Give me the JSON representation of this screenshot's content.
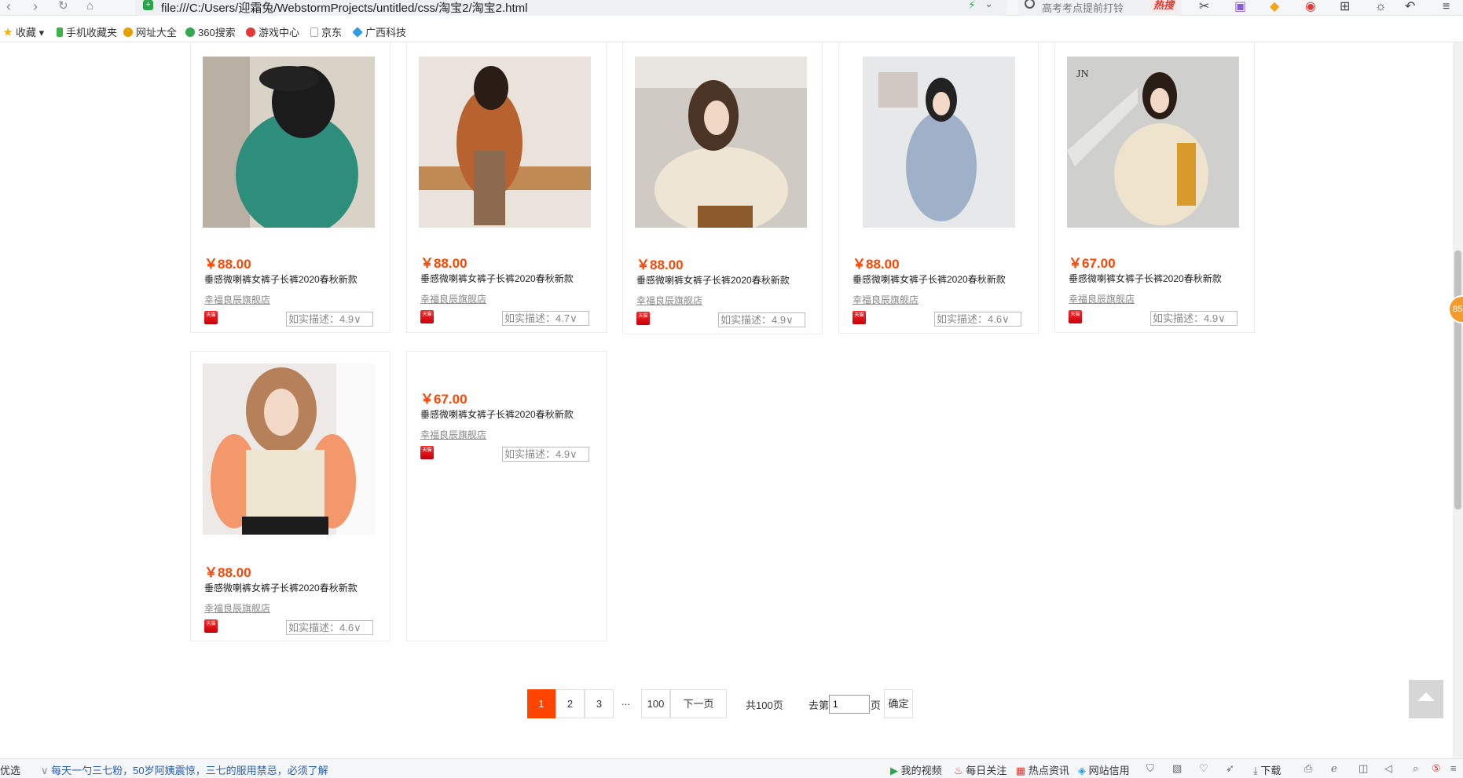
{
  "browser": {
    "url": "file:///C:/Users/迎霜兔/WebstormProjects/untitled/css/淘宝2/淘宝2.html",
    "search_placeholder": "高考考点提前打铃",
    "search_hot": "热搜"
  },
  "bookmarks": [
    {
      "label": "收藏",
      "icon": "star-icon",
      "color": "#f6b400"
    },
    {
      "label": "手机收藏夹",
      "icon": "phone-icon",
      "color": "#3bb34a"
    },
    {
      "label": "网址大全",
      "icon": "globe-icon",
      "color": "#e5a000"
    },
    {
      "label": "360搜索",
      "icon": "search360-icon",
      "color": "#32a852"
    },
    {
      "label": "游戏中心",
      "icon": "game-icon",
      "color": "#e53935"
    },
    {
      "label": "京东",
      "icon": "page-icon",
      "color": "#bbbbbb"
    },
    {
      "label": "广西科技",
      "icon": "diamond-icon",
      "color": "#2f9de0"
    }
  ],
  "products": [
    {
      "price": "￥88.00",
      "title": "垂感微喇裤女裤子长裤2020春秋新款",
      "shop": "幸福良辰旗舰店",
      "badge": "天猫",
      "rating": "如实描述：4.9∨",
      "palette": [
        "#d9d2c7",
        "#2d8f7b",
        "#1b1b1b"
      ]
    },
    {
      "price": "￥88.00",
      "title": "垂感微喇裤女裤子长裤2020春秋新款",
      "shop": "幸福良辰旗舰店",
      "badge": "天猫",
      "rating": "如实描述：4.7∨",
      "palette": [
        "#e9e3dc",
        "#b8632f",
        "#8c6a4f"
      ]
    },
    {
      "price": "￥88.00",
      "title": "垂感微喇裤女裤子长裤2020春秋新款",
      "shop": "幸福良辰旗舰店",
      "badge": "天猫",
      "rating": "如实描述：4.9∨",
      "palette": [
        "#cfcac4",
        "#efe5d4",
        "#4a3426"
      ]
    },
    {
      "price": "￥88.00",
      "title": "垂感微喇裤女裤子长裤2020春秋新款",
      "shop": "幸福良辰旗舰店",
      "badge": "天猫",
      "rating": "如实描述：4.6∨",
      "palette": [
        "#e7e8ea",
        "#9fb1c8",
        "#222222"
      ]
    },
    {
      "price": "￥67.00",
      "title": "垂感微喇裤女裤子长裤2020春秋新款",
      "shop": "幸福良辰旗舰店",
      "badge": "天猫",
      "rating": "如实描述：4.9∨",
      "palette": [
        "#cfcfcd",
        "#eee3cd",
        "#d89a2b"
      ]
    },
    {
      "price": "￥88.00",
      "title": "垂感微喇裤女裤子长裤2020春秋新款",
      "shop": "幸福良辰旗舰店",
      "badge": "天猫",
      "rating": "如实描述：4.6∨",
      "palette": [
        "#ece9e6",
        "#f4976b",
        "#efe6d2"
      ]
    },
    {
      "price": "￥67.00",
      "title": "垂感微喇裤女裤子长裤2020春秋新款",
      "shop": "幸福良辰旗舰店",
      "badge": "天猫",
      "rating": "如实描述：4.9∨",
      "palette": null
    }
  ],
  "pagination": {
    "pages": [
      "1",
      "2",
      "3"
    ],
    "ellipsis": "...",
    "last": "100",
    "next": "下一页",
    "total": "共100页",
    "goto_prefix": "去第",
    "goto_value": "1",
    "goto_suffix": "页",
    "confirm": "确定"
  },
  "side_badge": "85",
  "statusbar": {
    "left": "优选",
    "news": "每天一勺三七粉，50岁阿姨震惊，三七的服用禁忌，必须了解",
    "video": "我的视频",
    "follow": "每日关注",
    "hot": "热点资讯",
    "credit": "网站信用",
    "download": "下载"
  }
}
